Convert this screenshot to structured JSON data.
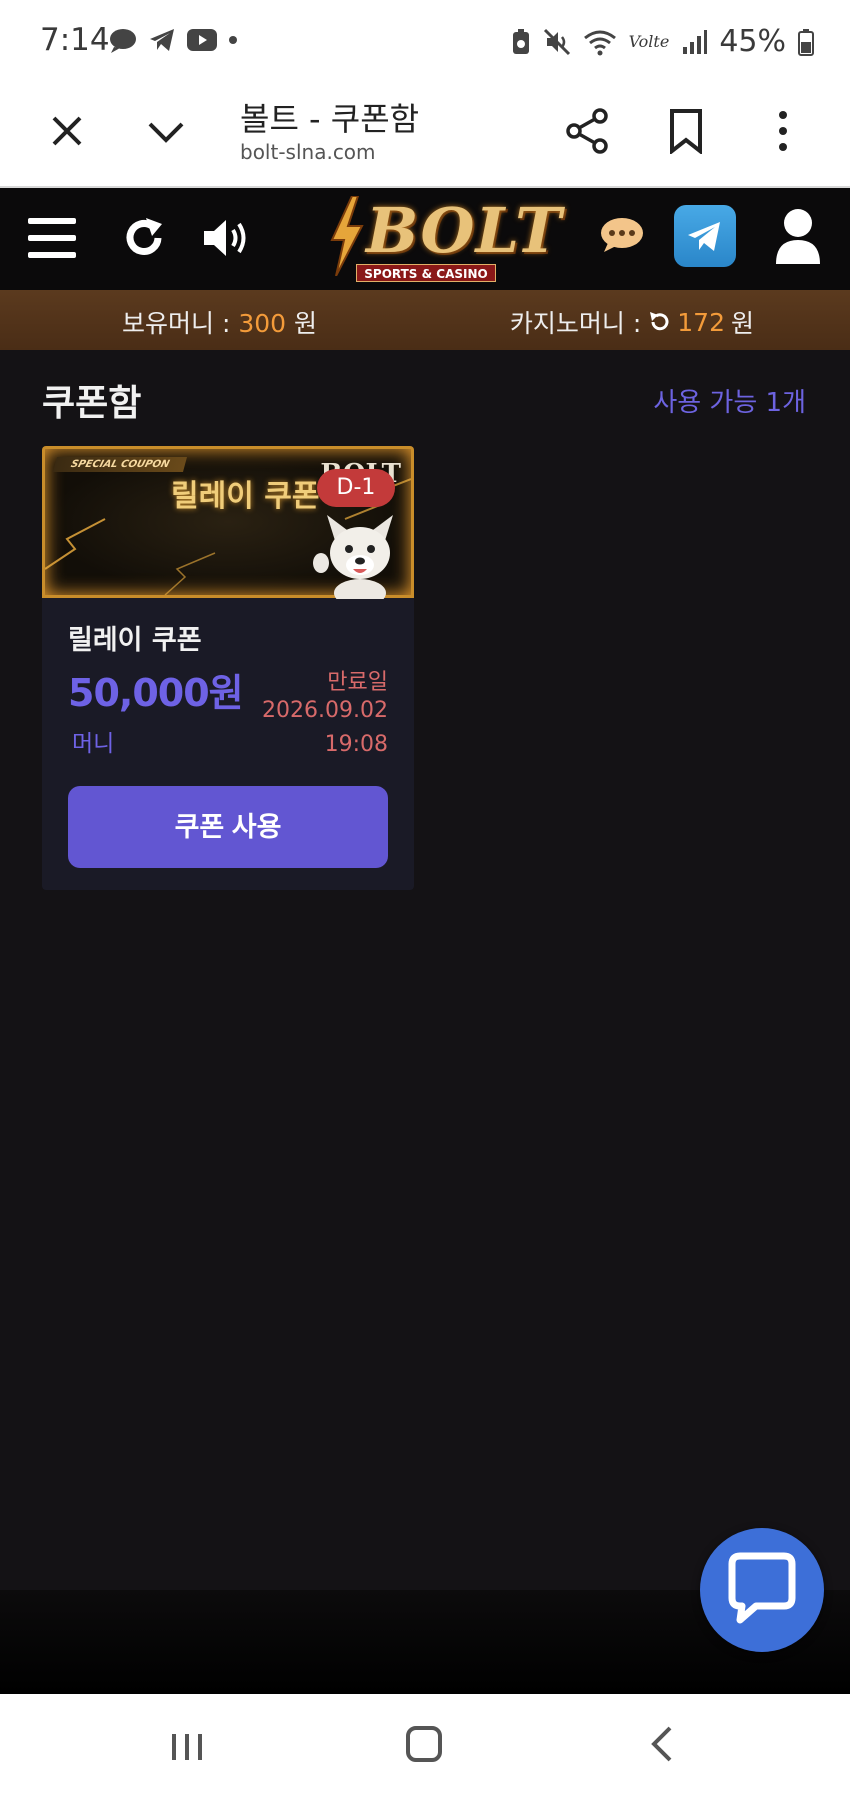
{
  "status_bar": {
    "time": "7:14",
    "battery": "45%",
    "network": "Volte"
  },
  "browser": {
    "title": "볼트 - 쿠폰함",
    "url": "bolt-slna.com"
  },
  "site": {
    "logo_text": "BOLT",
    "logo_sub": "SPORTS & CASINO"
  },
  "balance": {
    "money_label": "보유머니 : ",
    "money_value": "300",
    "money_unit": " 원",
    "casino_label": "카지노머니 : ",
    "casino_value": "172",
    "casino_unit": " 원"
  },
  "page": {
    "title": "쿠폰함",
    "available_label": "사용 가능 1개"
  },
  "coupons": [
    {
      "banner_tag": "SPECIAL COUPON",
      "banner_title": "릴레이 쿠폰",
      "banner_brand": "BOLT",
      "d_badge": "D-1",
      "name": "릴레이 쿠폰",
      "amount": "50,000원",
      "type": "머니",
      "expiry_label": "만료일",
      "expiry_date": "2026.09.02",
      "expiry_time": "19:08",
      "button_label": "쿠폰 사용"
    }
  ],
  "colors": {
    "accent": "#6256d2",
    "orange": "#f39b3a",
    "expiry": "#d86a6a",
    "chat_fab": "#3d6fd8"
  }
}
